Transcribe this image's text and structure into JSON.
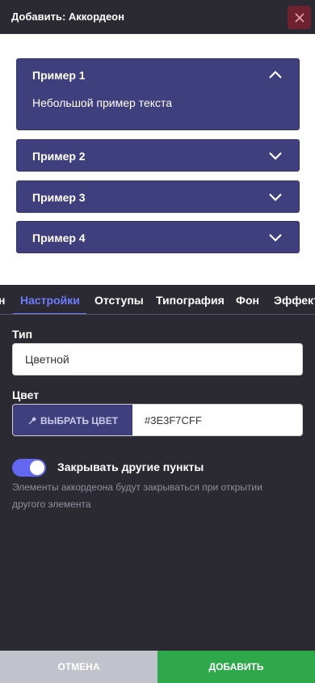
{
  "header": {
    "title": "Добавить: Аккордеон",
    "close_icon": "close-icon"
  },
  "preview": {
    "items": [
      {
        "title": "Пример 1",
        "body": "Небольшой пример текста",
        "expanded": true
      },
      {
        "title": "Пример 2",
        "expanded": false
      },
      {
        "title": "Пример 3",
        "expanded": false
      },
      {
        "title": "Пример 4",
        "expanded": false
      }
    ]
  },
  "tabs": {
    "items": [
      "н",
      "Настройки",
      "Отступы",
      "Типография",
      "Фон",
      "Эффекты"
    ],
    "active": "Настройки"
  },
  "settings": {
    "type_label": "Тип",
    "type_value": "Цветной",
    "color_label": "Цвет",
    "pick_color_label": "ВЫБРАТЬ ЦВЕТ",
    "color_value": "#3E3F7CFF",
    "close_others_label": "Закрывать другие пункты",
    "close_others_enabled": true,
    "close_others_help": "Элементы аккордеона будут закрываться при открытии другого элемента"
  },
  "footer": {
    "cancel_label": "ОТМЕНА",
    "add_label": "ДОБАВИТЬ"
  },
  "colors": {
    "accordion": "#3E3F7C",
    "accent": "#6E7CFF",
    "add": "#2EA84A",
    "cancel": "#C1C3CC",
    "close": "#6E2230"
  }
}
